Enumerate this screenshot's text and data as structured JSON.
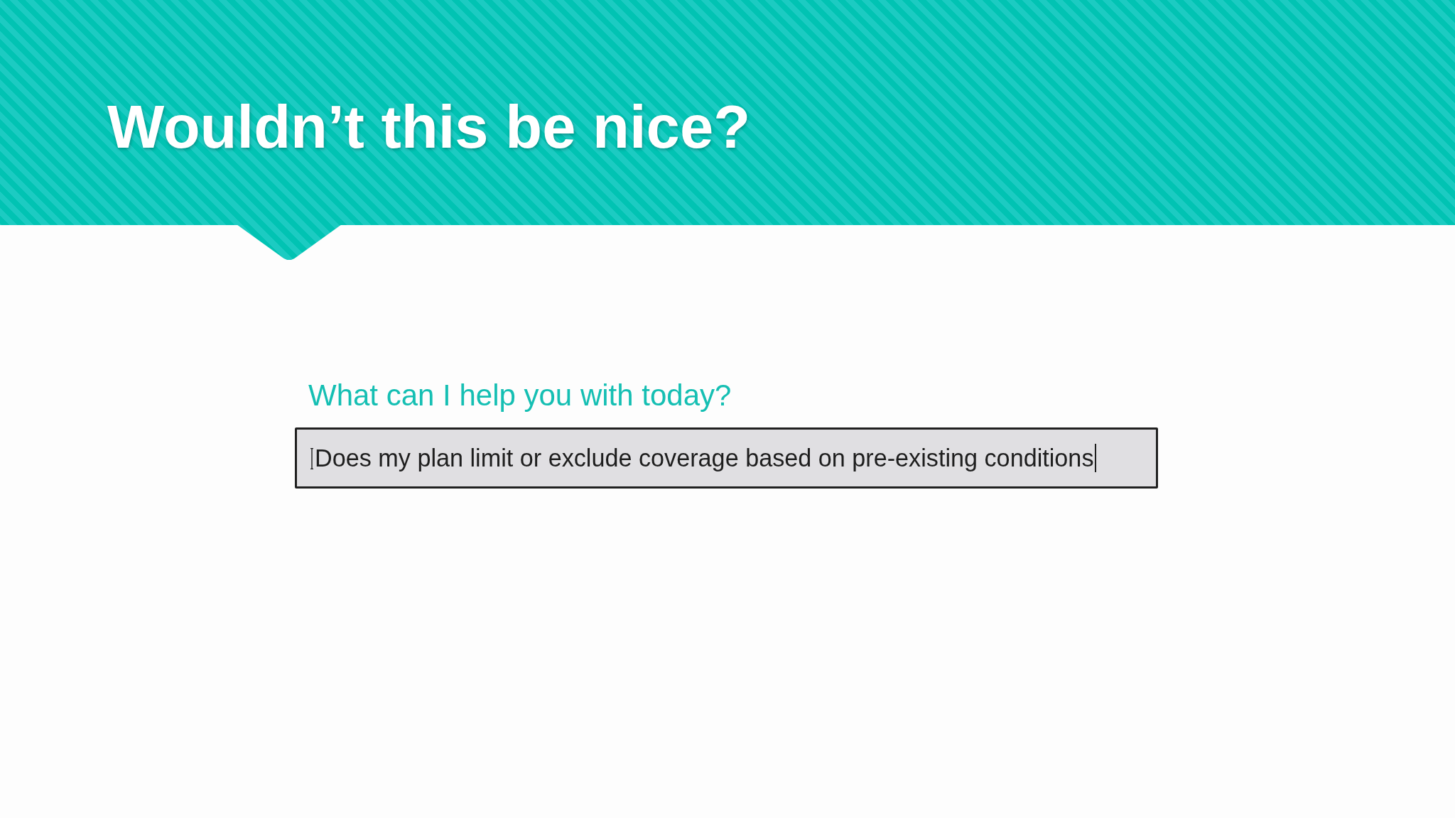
{
  "header": {
    "title": "Wouldn’t this be nice?"
  },
  "prompt": {
    "label": "What can I help you with today?",
    "value": "Does my plan limit or exclude coverage based on pre-existing conditions",
    "focused": true
  }
}
